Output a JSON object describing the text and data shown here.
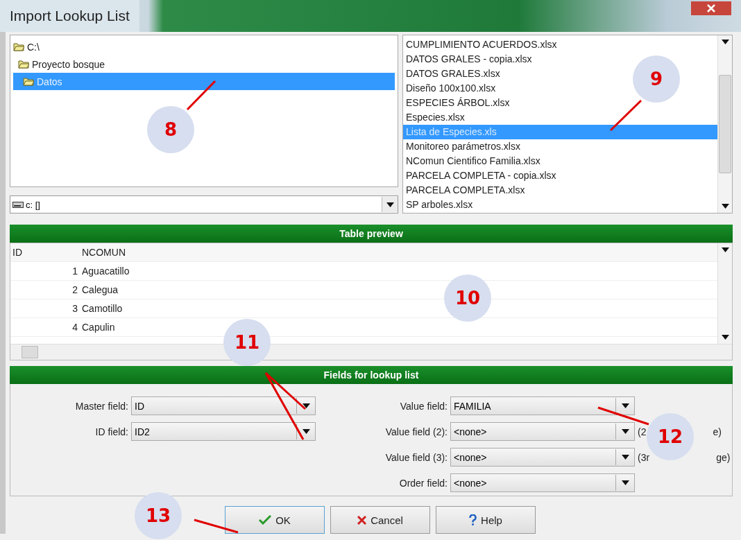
{
  "window": {
    "title": "Import Lookup List"
  },
  "folders": [
    {
      "label": "C:\\",
      "selected": false,
      "children": [
        {
          "label": "Proyecto bosque",
          "selected": false,
          "children": [
            {
              "label": "Datos",
              "selected": true
            }
          ]
        }
      ]
    }
  ],
  "drive": {
    "value": "c: []"
  },
  "files": [
    {
      "label": "CUMPLIMIENTO ACUERDOS.xlsx",
      "selected": false
    },
    {
      "label": "DATOS GRALES - copia.xlsx",
      "selected": false
    },
    {
      "label": "DATOS GRALES.xlsx",
      "selected": false
    },
    {
      "label": "Diseño 100x100.xlsx",
      "selected": false
    },
    {
      "label": "ESPECIES ÁRBOL.xlsx",
      "selected": false
    },
    {
      "label": "Especies.xlsx",
      "selected": false
    },
    {
      "label": "Lista de Especies.xls",
      "selected": true
    },
    {
      "label": "Monitoreo parámetros.xlsx",
      "selected": false
    },
    {
      "label": "NComun Cientifico Familia.xlsx",
      "selected": false
    },
    {
      "label": "PARCELA COMPLETA - copia.xlsx",
      "selected": false
    },
    {
      "label": "PARCELA COMPLETA.xlsx",
      "selected": false
    },
    {
      "label": "SP arboles.xlsx",
      "selected": false
    }
  ],
  "table_preview": {
    "title": "Table preview",
    "columns": [
      "ID",
      "NCOMUN"
    ],
    "rows": [
      [
        "1",
        "Aguacatillo"
      ],
      [
        "2",
        "Calegua"
      ],
      [
        "3",
        "Camotillo"
      ],
      [
        "4",
        "Capulin"
      ]
    ]
  },
  "fields_panel": {
    "title": "Fields for lookup list",
    "left": [
      {
        "label": "Master field:",
        "value": "ID"
      },
      {
        "label": "ID field:",
        "value": "ID2"
      }
    ],
    "right": [
      {
        "label": "Value field:",
        "value": "FAMILIA"
      },
      {
        "label": "Value field (2):",
        "value": "<none>",
        "hint_start": "(2",
        "hint_end": "e)"
      },
      {
        "label": "Value field (3):",
        "value": "<none>",
        "hint_start": "(3r",
        "hint_end": "ge)"
      },
      {
        "label": "Order field:",
        "value": "<none>"
      }
    ]
  },
  "buttons": [
    {
      "label": "OK",
      "kind": "ok"
    },
    {
      "label": "Cancel",
      "kind": "cancel"
    },
    {
      "label": "Help",
      "kind": "help"
    }
  ],
  "annotations": [
    "8",
    "9",
    "10",
    "11",
    "12",
    "13"
  ]
}
